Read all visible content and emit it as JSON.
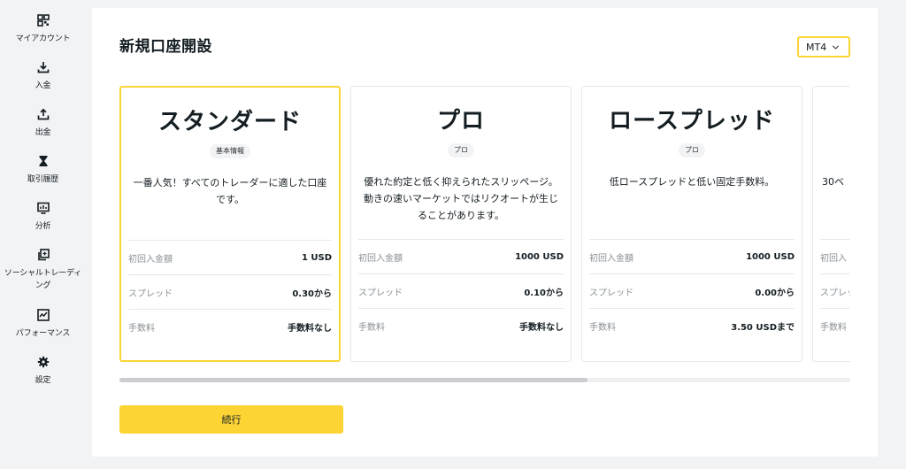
{
  "sidebar": {
    "items": [
      {
        "label": "マイアカウント",
        "icon": "dashboard-icon"
      },
      {
        "label": "入金",
        "icon": "download-icon"
      },
      {
        "label": "出金",
        "icon": "upload-icon"
      },
      {
        "label": "取引履歴",
        "icon": "hourglass-icon"
      },
      {
        "label": "分析",
        "icon": "analytics-icon"
      },
      {
        "label": "ソーシャルトレーディング",
        "icon": "copy-icon"
      },
      {
        "label": "パフォーマンス",
        "icon": "chart-icon"
      },
      {
        "label": "設定",
        "icon": "gear-icon"
      }
    ]
  },
  "main": {
    "title": "新規口座開設",
    "platform_select": {
      "value": "MT4"
    },
    "cards": [
      {
        "title": "スタンダード",
        "badge": "基本情報",
        "description": "一番人気！すべてのトレーダーに適した口座です。",
        "selected": true,
        "rows": [
          {
            "label": "初回入金額",
            "value": "1 USD"
          },
          {
            "label": "スプレッド",
            "value": "0.30から"
          },
          {
            "label": "手数料",
            "value": "手数料なし"
          }
        ]
      },
      {
        "title": "プロ",
        "badge": "プロ",
        "description": "優れた約定と低く抑えられたスリッページ。動きの速いマーケットではリクオートが生じることがあります。",
        "selected": false,
        "rows": [
          {
            "label": "初回入金額",
            "value": "1000 USD"
          },
          {
            "label": "スプレッド",
            "value": "0.10から"
          },
          {
            "label": "手数料",
            "value": "手数料なし"
          }
        ]
      },
      {
        "title": "ロースプレッド",
        "badge": "プロ",
        "description": "低ロースプレッドと低い固定手数料。",
        "selected": false,
        "rows": [
          {
            "label": "初回入金額",
            "value": "1000 USD"
          },
          {
            "label": "スプレッド",
            "value": "0.00から"
          },
          {
            "label": "手数料",
            "value": "3.50 USDまで"
          }
        ]
      },
      {
        "title": "",
        "badge": "",
        "description": "30ベ",
        "selected": false,
        "rows": [
          {
            "label": "初回入",
            "value": ""
          },
          {
            "label": "スプレッ",
            "value": ""
          },
          {
            "label": "手数料",
            "value": ""
          }
        ]
      }
    ],
    "scroll": {
      "position": 0.64
    },
    "continue_label": "続行"
  },
  "colors": {
    "accent": "#fcd535",
    "background": "#f2f3f5",
    "text": "#141d22",
    "muted": "#8a9095"
  }
}
